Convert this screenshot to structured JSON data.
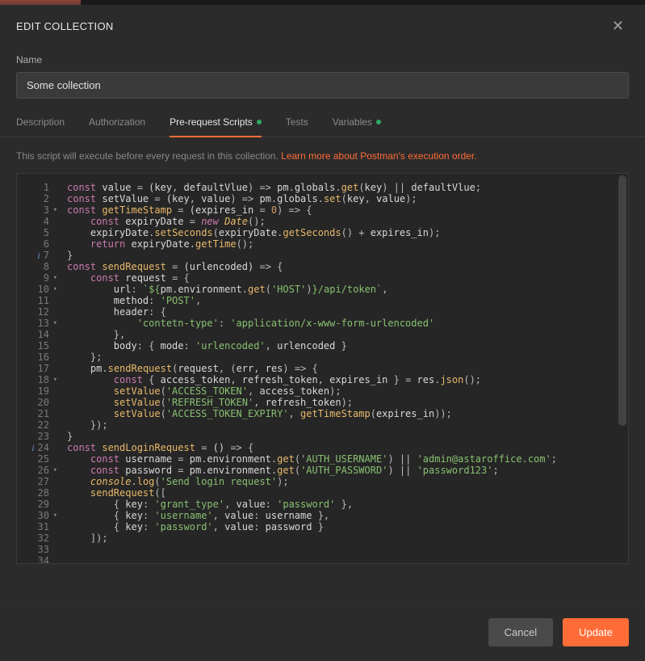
{
  "modal": {
    "title": "EDIT COLLECTION",
    "name_label": "Name",
    "name_value": "Some collection",
    "tabs": [
      {
        "label": "Description",
        "active": false,
        "dot": false
      },
      {
        "label": "Authorization",
        "active": false,
        "dot": false
      },
      {
        "label": "Pre-request Scripts",
        "active": true,
        "dot": true
      },
      {
        "label": "Tests",
        "active": false,
        "dot": false
      },
      {
        "label": "Variables",
        "active": false,
        "dot": true
      }
    ],
    "helper_text": "This script will execute before every request in this collection. ",
    "helper_link": "Learn more about Postman's execution order.",
    "cancel_label": "Cancel",
    "update_label": "Update"
  },
  "editor": {
    "gutter": [
      {
        "n": 1
      },
      {
        "n": 2
      },
      {
        "n": 3,
        "fold": true
      },
      {
        "n": 4
      },
      {
        "n": 5
      },
      {
        "n": 6
      },
      {
        "n": 7,
        "info": true
      },
      {
        "n": 8
      },
      {
        "n": 9,
        "fold": true
      },
      {
        "n": 10,
        "fold": true
      },
      {
        "n": 11
      },
      {
        "n": 12
      },
      {
        "n": 13,
        "fold": true
      },
      {
        "n": 14
      },
      {
        "n": 15
      },
      {
        "n": 16
      },
      {
        "n": 17
      },
      {
        "n": 18,
        "fold": true
      },
      {
        "n": 19
      },
      {
        "n": 20
      },
      {
        "n": 21
      },
      {
        "n": 22
      },
      {
        "n": 23
      },
      {
        "n": 24,
        "info": true
      },
      {
        "n": 25
      },
      {
        "n": 26,
        "fold": true
      },
      {
        "n": 27
      },
      {
        "n": 28
      },
      {
        "n": 29
      },
      {
        "n": 30,
        "fold": true
      },
      {
        "n": 31
      },
      {
        "n": 32
      },
      {
        "n": 33
      },
      {
        "n": 34
      }
    ],
    "lines": [
      [
        [
          "kw",
          "const"
        ],
        [
          "id",
          " value "
        ],
        [
          "op",
          "="
        ],
        [
          "id",
          " (key"
        ],
        [
          "op",
          ","
        ],
        [
          "id",
          " defaultVlue"
        ],
        [
          "op",
          ") => "
        ],
        [
          "id",
          "pm"
        ],
        [
          "op",
          "."
        ],
        [
          "id",
          "globals"
        ],
        [
          "op",
          "."
        ],
        [
          "fn",
          "get"
        ],
        [
          "op",
          "("
        ],
        [
          "id",
          "key"
        ],
        [
          "op",
          ") || "
        ],
        [
          "id",
          "defaultVlue"
        ],
        [
          "op",
          ";"
        ]
      ],
      [
        [
          "kw",
          "const"
        ],
        [
          "id",
          " setValue "
        ],
        [
          "op",
          "="
        ],
        [
          "id",
          " (key"
        ],
        [
          "op",
          ","
        ],
        [
          "id",
          " value"
        ],
        [
          "op",
          ") => "
        ],
        [
          "id",
          "pm"
        ],
        [
          "op",
          "."
        ],
        [
          "id",
          "globals"
        ],
        [
          "op",
          "."
        ],
        [
          "fn",
          "set"
        ],
        [
          "op",
          "("
        ],
        [
          "id",
          "key"
        ],
        [
          "op",
          ", "
        ],
        [
          "id",
          "value"
        ],
        [
          "op",
          ");"
        ]
      ],
      [
        [
          "kw",
          "const"
        ],
        [
          "id",
          " "
        ],
        [
          "fn",
          "getTimeStamp"
        ],
        [
          "id",
          " "
        ],
        [
          "op",
          "="
        ],
        [
          "id",
          " (expires_in "
        ],
        [
          "op",
          "= "
        ],
        [
          "num",
          "0"
        ],
        [
          "op",
          ") => {"
        ]
      ],
      [
        [
          "id",
          "    "
        ],
        [
          "kw",
          "const"
        ],
        [
          "id",
          " expiryDate "
        ],
        [
          "op",
          "= "
        ],
        [
          "new",
          "new"
        ],
        [
          "id",
          " "
        ],
        [
          "type",
          "Date"
        ],
        [
          "op",
          "();"
        ]
      ],
      [
        [
          "id",
          "    expiryDate"
        ],
        [
          "op",
          "."
        ],
        [
          "fn",
          "setSeconds"
        ],
        [
          "op",
          "("
        ],
        [
          "id",
          "expiryDate"
        ],
        [
          "op",
          "."
        ],
        [
          "fn",
          "getSeconds"
        ],
        [
          "op",
          "() + "
        ],
        [
          "id",
          "expires_in"
        ],
        [
          "op",
          ");"
        ]
      ],
      [
        [
          "id",
          "    "
        ],
        [
          "kw",
          "return"
        ],
        [
          "id",
          " expiryDate"
        ],
        [
          "op",
          "."
        ],
        [
          "fn",
          "getTime"
        ],
        [
          "op",
          "();"
        ]
      ],
      [
        [
          "op",
          "}"
        ]
      ],
      [
        [
          "id",
          ""
        ]
      ],
      [
        [
          "kw",
          "const"
        ],
        [
          "id",
          " "
        ],
        [
          "fn",
          "sendRequest"
        ],
        [
          "id",
          " "
        ],
        [
          "op",
          "="
        ],
        [
          "id",
          " (urlencoded) "
        ],
        [
          "op",
          "=> {"
        ]
      ],
      [
        [
          "id",
          "    "
        ],
        [
          "kw",
          "const"
        ],
        [
          "id",
          " request "
        ],
        [
          "op",
          "= {"
        ]
      ],
      [
        [
          "id",
          "        url"
        ],
        [
          "op",
          ": "
        ],
        [
          "str",
          "`${"
        ],
        [
          "id",
          "pm"
        ],
        [
          "op",
          "."
        ],
        [
          "id",
          "environment"
        ],
        [
          "op",
          "."
        ],
        [
          "fn",
          "get"
        ],
        [
          "op",
          "("
        ],
        [
          "str",
          "'HOST'"
        ],
        [
          "op",
          ")"
        ],
        [
          "str",
          "}/api/token`"
        ],
        [
          "op",
          ","
        ]
      ],
      [
        [
          "id",
          "        method"
        ],
        [
          "op",
          ": "
        ],
        [
          "str",
          "'POST'"
        ],
        [
          "op",
          ","
        ]
      ],
      [
        [
          "id",
          "        header"
        ],
        [
          "op",
          ": {"
        ]
      ],
      [
        [
          "id",
          "            "
        ],
        [
          "str",
          "'contetn-type'"
        ],
        [
          "op",
          ": "
        ],
        [
          "str",
          "'application/x-www-form-urlencoded'"
        ]
      ],
      [
        [
          "id",
          "        "
        ],
        [
          "op",
          "},"
        ]
      ],
      [
        [
          "id",
          "        body"
        ],
        [
          "op",
          ": { "
        ],
        [
          "id",
          "mode"
        ],
        [
          "op",
          ": "
        ],
        [
          "str",
          "'urlencoded'"
        ],
        [
          "op",
          ", "
        ],
        [
          "id",
          "urlencoded"
        ],
        [
          "op",
          " }"
        ]
      ],
      [
        [
          "id",
          "    "
        ],
        [
          "op",
          "};"
        ]
      ],
      [
        [
          "id",
          "    pm"
        ],
        [
          "op",
          "."
        ],
        [
          "fn",
          "sendRequest"
        ],
        [
          "op",
          "("
        ],
        [
          "id",
          "request"
        ],
        [
          "op",
          ", ("
        ],
        [
          "id",
          "err"
        ],
        [
          "op",
          ", "
        ],
        [
          "id",
          "res"
        ],
        [
          "op",
          ") => {"
        ]
      ],
      [
        [
          "id",
          "        "
        ],
        [
          "kw",
          "const"
        ],
        [
          "id",
          " "
        ],
        [
          "op",
          "{ "
        ],
        [
          "id",
          "access_token"
        ],
        [
          "op",
          ", "
        ],
        [
          "id",
          "refresh_token"
        ],
        [
          "op",
          ", "
        ],
        [
          "id",
          "expires_in"
        ],
        [
          "op",
          " } = "
        ],
        [
          "id",
          "res"
        ],
        [
          "op",
          "."
        ],
        [
          "fn",
          "json"
        ],
        [
          "op",
          "();"
        ]
      ],
      [
        [
          "id",
          "        "
        ],
        [
          "fn",
          "setValue"
        ],
        [
          "op",
          "("
        ],
        [
          "str",
          "'ACCESS_TOKEN'"
        ],
        [
          "op",
          ", "
        ],
        [
          "id",
          "access_token"
        ],
        [
          "op",
          ");"
        ]
      ],
      [
        [
          "id",
          "        "
        ],
        [
          "fn",
          "setValue"
        ],
        [
          "op",
          "("
        ],
        [
          "str",
          "'REFRESH_TOKEN'"
        ],
        [
          "op",
          ", "
        ],
        [
          "id",
          "refresh_token"
        ],
        [
          "op",
          ");"
        ]
      ],
      [
        [
          "id",
          "        "
        ],
        [
          "fn",
          "setValue"
        ],
        [
          "op",
          "("
        ],
        [
          "str",
          "'ACCESS_TOKEN_EXPIRY'"
        ],
        [
          "op",
          ", "
        ],
        [
          "fn",
          "getTimeStamp"
        ],
        [
          "op",
          "("
        ],
        [
          "id",
          "expires_in"
        ],
        [
          "op",
          "));"
        ]
      ],
      [
        [
          "id",
          "    "
        ],
        [
          "op",
          "});"
        ]
      ],
      [
        [
          "op",
          "}"
        ]
      ],
      [
        [
          "id",
          ""
        ]
      ],
      [
        [
          "kw",
          "const"
        ],
        [
          "id",
          " "
        ],
        [
          "fn",
          "sendLoginRequest"
        ],
        [
          "id",
          " "
        ],
        [
          "op",
          "="
        ],
        [
          "id",
          " () "
        ],
        [
          "op",
          "=> {"
        ]
      ],
      [
        [
          "id",
          "    "
        ],
        [
          "kw",
          "const"
        ],
        [
          "id",
          " username "
        ],
        [
          "op",
          "= "
        ],
        [
          "id",
          "pm"
        ],
        [
          "op",
          "."
        ],
        [
          "id",
          "environment"
        ],
        [
          "op",
          "."
        ],
        [
          "fn",
          "get"
        ],
        [
          "op",
          "("
        ],
        [
          "str",
          "'AUTH_USERNAME'"
        ],
        [
          "op",
          ") || "
        ],
        [
          "str",
          "'admin@astaroffice.com'"
        ],
        [
          "op",
          ";"
        ]
      ],
      [
        [
          "id",
          "    "
        ],
        [
          "kw",
          "const"
        ],
        [
          "id",
          " password "
        ],
        [
          "op",
          "= "
        ],
        [
          "id",
          "pm"
        ],
        [
          "op",
          "."
        ],
        [
          "id",
          "environment"
        ],
        [
          "op",
          "."
        ],
        [
          "fn",
          "get"
        ],
        [
          "op",
          "("
        ],
        [
          "str",
          "'AUTH_PASSWORD'"
        ],
        [
          "op",
          ") || "
        ],
        [
          "str",
          "'password123'"
        ],
        [
          "op",
          ";"
        ]
      ],
      [
        [
          "id",
          "    "
        ],
        [
          "type",
          "console"
        ],
        [
          "op",
          "."
        ],
        [
          "fn",
          "log"
        ],
        [
          "op",
          "("
        ],
        [
          "str",
          "'Send login request'"
        ],
        [
          "op",
          ");"
        ]
      ],
      [
        [
          "id",
          "    "
        ],
        [
          "fn",
          "sendRequest"
        ],
        [
          "op",
          "(["
        ]
      ],
      [
        [
          "id",
          "        "
        ],
        [
          "op",
          "{ "
        ],
        [
          "id",
          "key"
        ],
        [
          "op",
          ": "
        ],
        [
          "str",
          "'grant_type'"
        ],
        [
          "op",
          ", "
        ],
        [
          "id",
          "value"
        ],
        [
          "op",
          ": "
        ],
        [
          "str",
          "'password'"
        ],
        [
          "op",
          " },"
        ]
      ],
      [
        [
          "id",
          "        "
        ],
        [
          "op",
          "{ "
        ],
        [
          "id",
          "key"
        ],
        [
          "op",
          ": "
        ],
        [
          "str",
          "'username'"
        ],
        [
          "op",
          ", "
        ],
        [
          "id",
          "value"
        ],
        [
          "op",
          ": "
        ],
        [
          "id",
          "username"
        ],
        [
          "op",
          " },"
        ]
      ],
      [
        [
          "id",
          "        "
        ],
        [
          "op",
          "{ "
        ],
        [
          "id",
          "key"
        ],
        [
          "op",
          ": "
        ],
        [
          "str",
          "'password'"
        ],
        [
          "op",
          ", "
        ],
        [
          "id",
          "value"
        ],
        [
          "op",
          ": "
        ],
        [
          "id",
          "password"
        ],
        [
          "op",
          " }"
        ]
      ],
      [
        [
          "id",
          "    "
        ],
        [
          "op",
          "]);"
        ]
      ]
    ]
  }
}
